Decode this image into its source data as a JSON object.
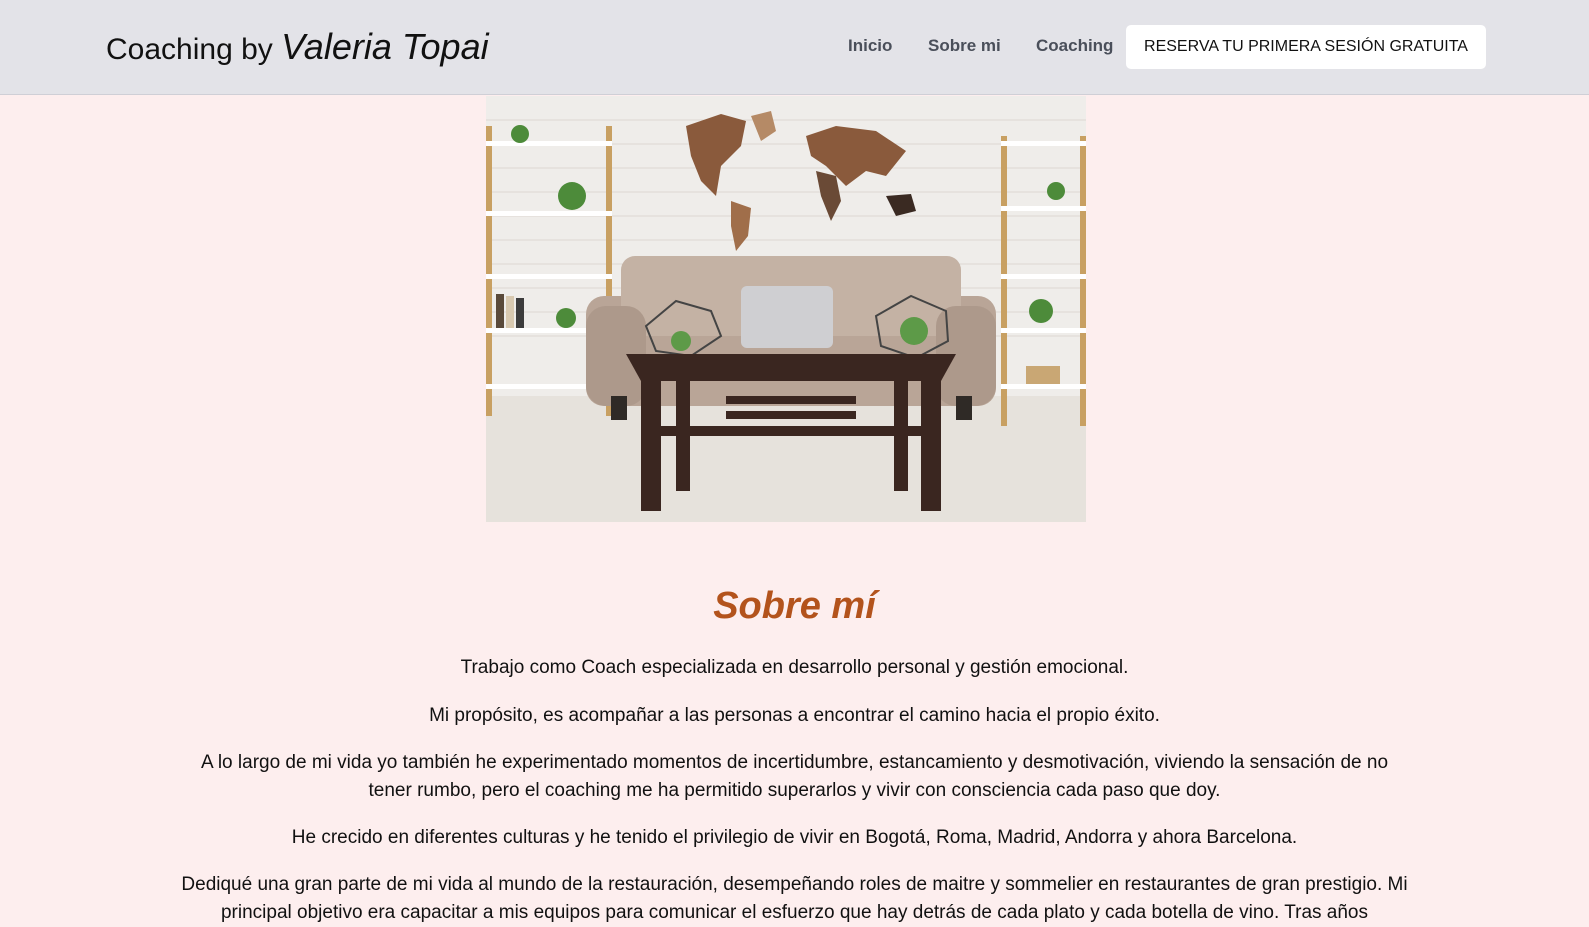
{
  "header": {
    "brand_prefix": "Coaching by",
    "brand_name": "Valeria Topai",
    "nav": [
      "Inicio",
      "Sobre mi",
      "Coaching"
    ],
    "cta_label": "RESERVA TU PRIMERA SESIÓN GRATUITA"
  },
  "main": {
    "title": "Sobre mí",
    "paragraphs": [
      "Trabajo como Coach especializada en desarrollo personal y gestión emocional.",
      "Mi propósito, es acompañar a las personas a encontrar el camino hacia el propio éxito.",
      "A lo largo de mi vida yo también he experimentado momentos de incertidumbre, estancamiento y desmotivación, viviendo la sensación de no tener rumbo, pero el coaching me ha permitido superarlos y vivir con consciencia cada paso que doy.",
      "He crecido en diferentes culturas y he tenido el privilegio de vivir en Bogotá, Roma, Madrid, Andorra y ahora Barcelona.",
      "Dediqué una gran parte de mi vida al mundo de la restauración, desempeñando roles de maitre y sommelier en restaurantes de gran prestigio. Mi principal objetivo era capacitar a mis equipos para comunicar el esfuerzo que hay detrás de cada plato y cada botella de vino. Tras años"
    ]
  },
  "colors": {
    "page_background": "#fdeeee",
    "header_background": "#e3e3e8",
    "title_accent": "#b3531c"
  }
}
